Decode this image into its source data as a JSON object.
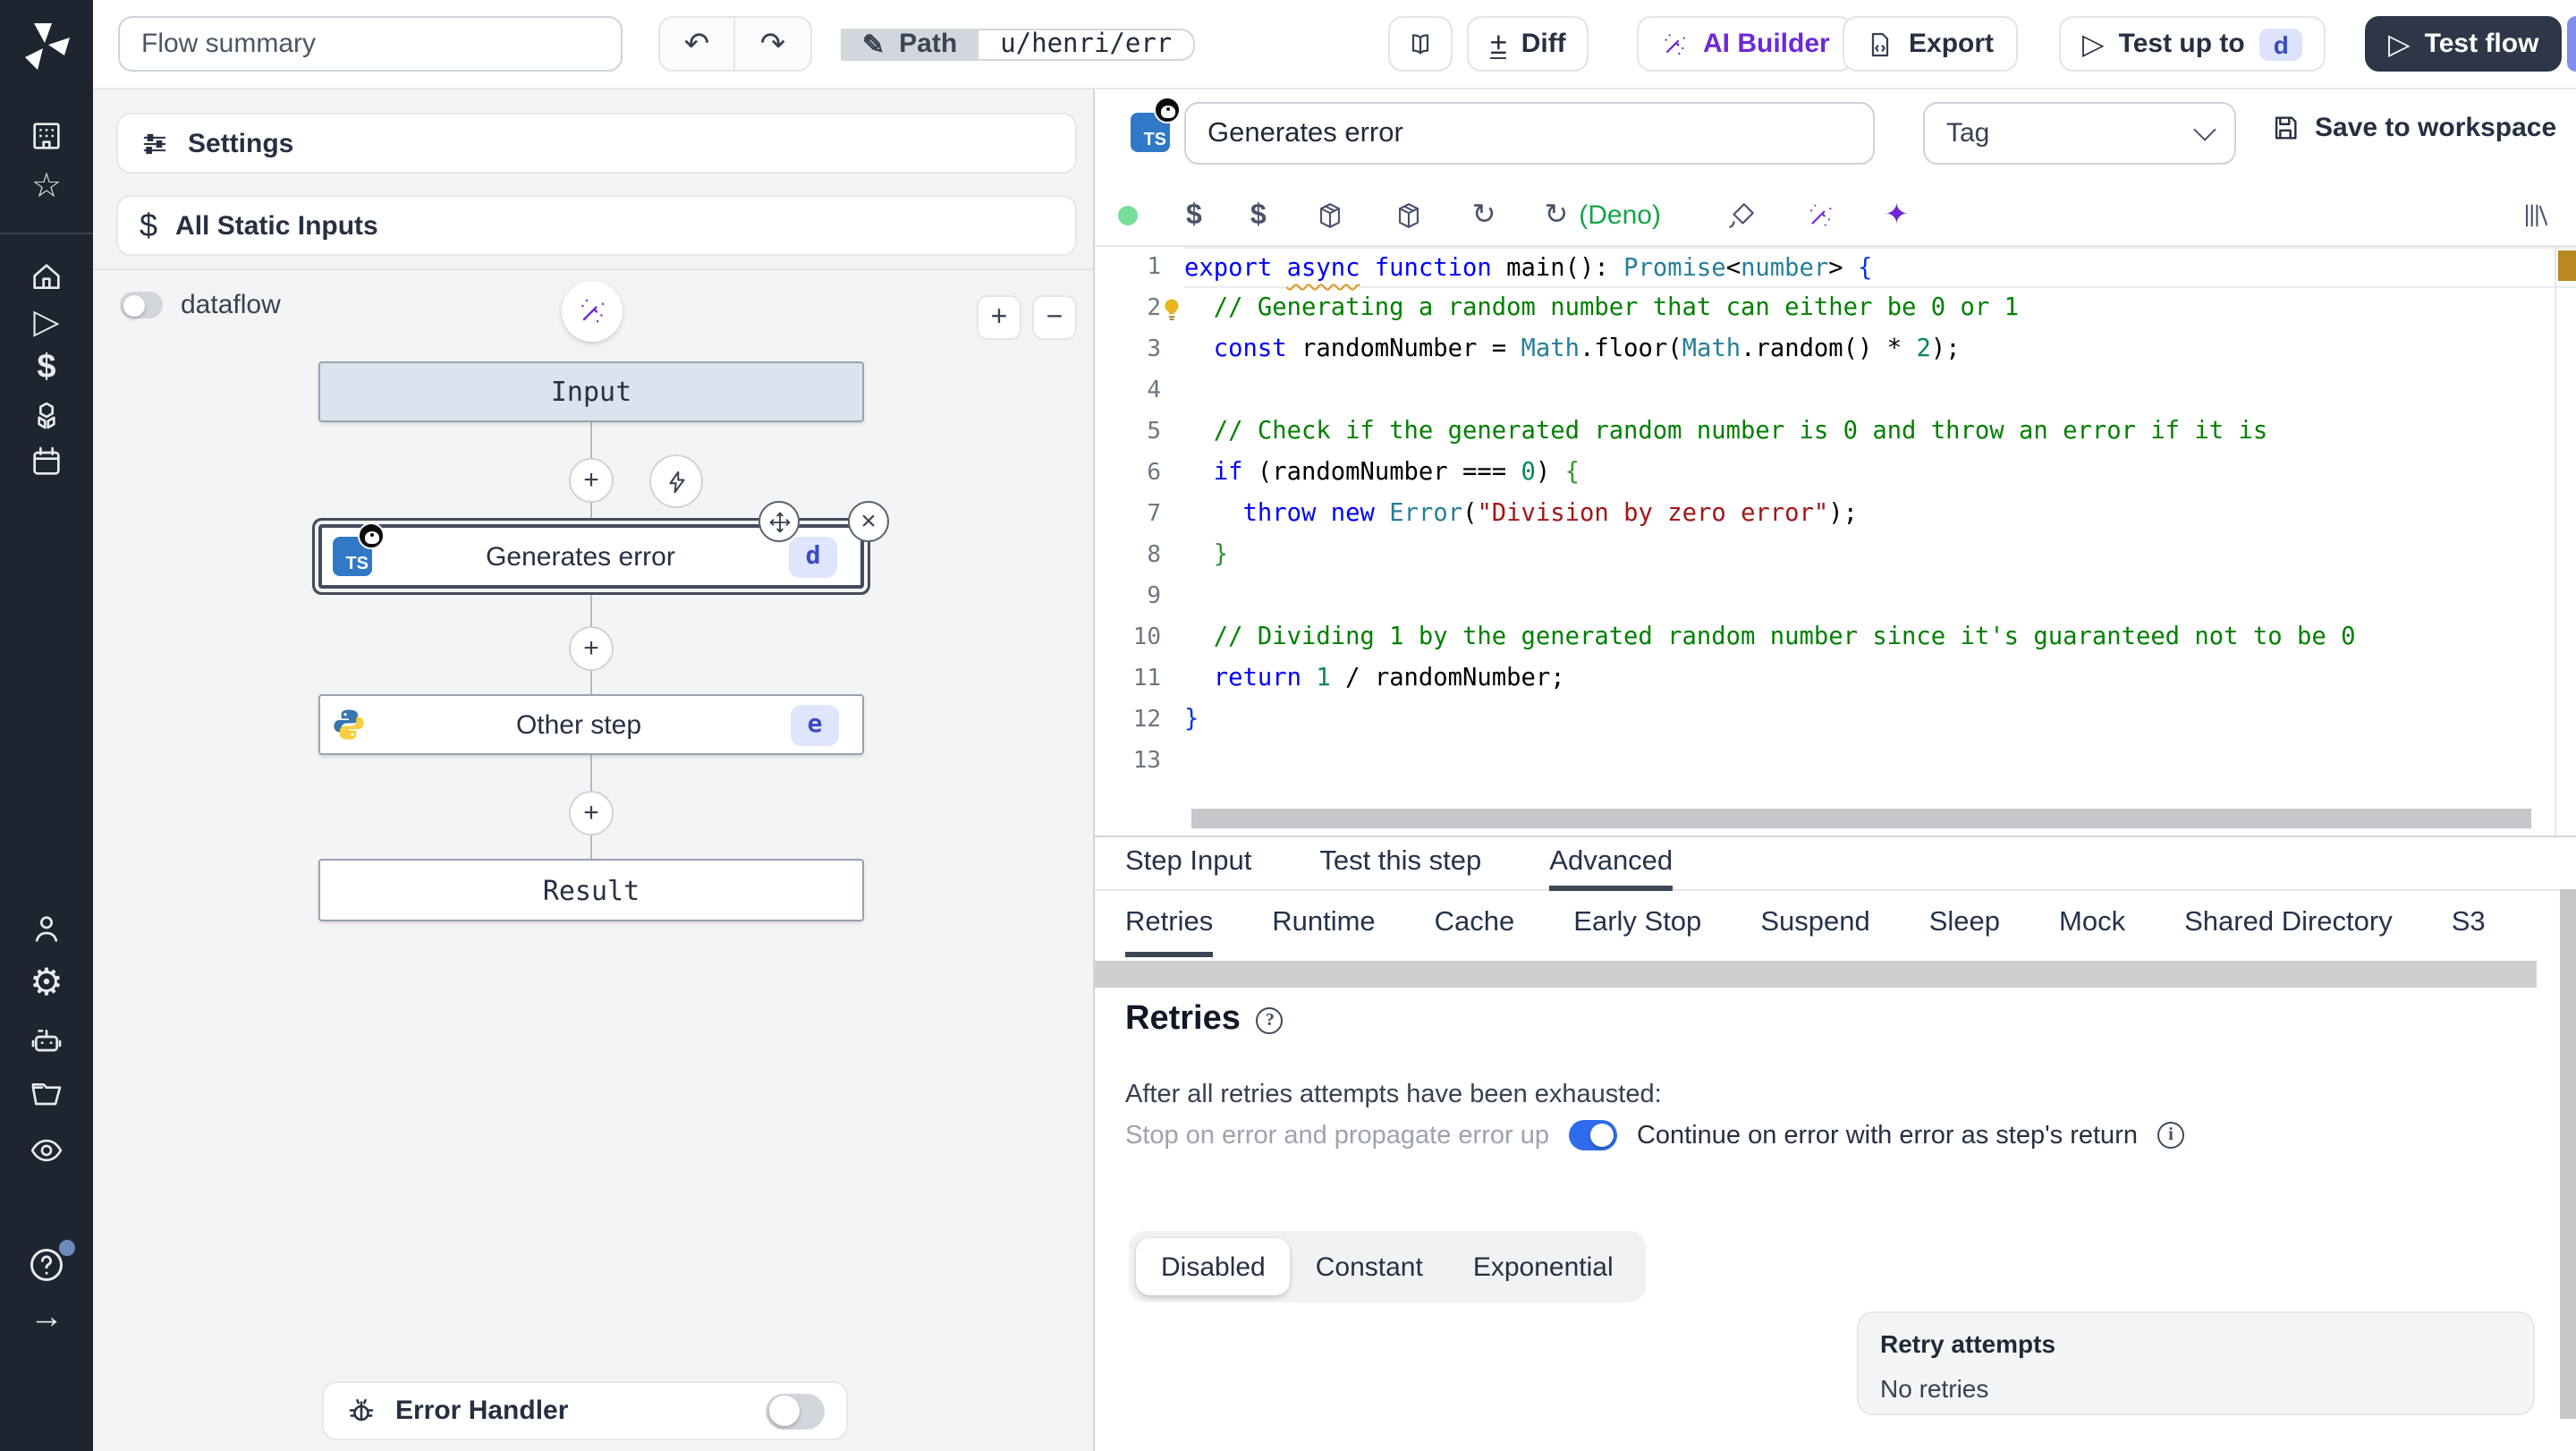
{
  "colors": {
    "accent_blue": "#2f6ceb",
    "ai_purple": "#6d28d9",
    "deno_green": "#16a34a",
    "dark_button": "#2e3748",
    "warning_marker": "#b8891f",
    "sidebar_bg": "#1e2430"
  },
  "icons": {
    "undo": "↶",
    "redo": "↷",
    "pencil": "✎",
    "diff": "±",
    "play": "▷",
    "home": "⌂",
    "star": "☆",
    "gear": "⚙",
    "arrow_right": "→",
    "dollar": "$",
    "help": "?",
    "refresh": "↻",
    "sparkles": "✦",
    "plus": "+",
    "minus": "−",
    "close": "×",
    "move": "✛"
  },
  "topbar": {
    "flow_summary_value": "Flow summary",
    "path_label": "Path",
    "path_value": "u/henri/err",
    "diff_label": "Diff",
    "ai_builder_label": "AI Builder",
    "export_label": "Export",
    "test_up_to_label": "Test up to",
    "test_up_to_badge": "d",
    "test_flow_label": "Test flow"
  },
  "flow_panel": {
    "settings_label": "Settings",
    "static_inputs_label": "All Static Inputs",
    "dataflow_label": "dataflow",
    "input_node": "Input",
    "step_d": {
      "label": "Generates error",
      "id": "d"
    },
    "step_e": {
      "label": "Other step",
      "id": "e"
    },
    "result_node": "Result",
    "error_handler_label": "Error Handler"
  },
  "step_panel": {
    "name_value": "Generates error",
    "tag_placeholder": "Tag",
    "save_label": "Save to workspace",
    "runtime_label": "(Deno)",
    "tabs": [
      {
        "label": "Step Input",
        "active": false
      },
      {
        "label": "Test this step",
        "active": false
      },
      {
        "label": "Advanced",
        "active": true
      }
    ],
    "subtabs": [
      {
        "label": "Retries",
        "active": true
      },
      {
        "label": "Runtime",
        "active": false
      },
      {
        "label": "Cache",
        "active": false
      },
      {
        "label": "Early Stop",
        "active": false
      },
      {
        "label": "Suspend",
        "active": false
      },
      {
        "label": "Sleep",
        "active": false
      },
      {
        "label": "Mock",
        "active": false
      },
      {
        "label": "Shared Directory",
        "active": false
      },
      {
        "label": "S3",
        "active": false
      }
    ],
    "retries": {
      "title": "Retries",
      "exhausted_text": "After all retries attempts have been exhausted:",
      "stop_label": "Stop on error and propagate error up",
      "continue_label": "Continue on error with error as step's return",
      "toggle_on": true,
      "modes": [
        {
          "label": "Disabled",
          "active": true
        },
        {
          "label": "Constant",
          "active": false
        },
        {
          "label": "Exponential",
          "active": false
        }
      ],
      "box_title": "Retry attempts",
      "box_value": "No retries"
    }
  },
  "code": {
    "active_line": 1,
    "bulb_line": 2,
    "lines": [
      [
        [
          "k",
          "export "
        ],
        [
          "k sq",
          "async"
        ],
        [
          "k",
          " function "
        ],
        [
          "",
          "main(): "
        ],
        [
          "t",
          "Promise"
        ],
        [
          "",
          "<"
        ],
        [
          "t",
          "number"
        ],
        [
          "",
          ">"
        ],
        [
          "b1",
          " {"
        ]
      ],
      [
        [
          "",
          "  "
        ],
        [
          "c",
          "// Generating a random number that can either be 0 or 1"
        ]
      ],
      [
        [
          "",
          "  "
        ],
        [
          "k",
          "const "
        ],
        [
          "",
          "randomNumber = "
        ],
        [
          "t",
          "Math"
        ],
        [
          "",
          ".floor("
        ],
        [
          "t",
          "Math"
        ],
        [
          "",
          ".random() * "
        ],
        [
          "n",
          "2"
        ],
        [
          "",
          ");"
        ]
      ],
      [],
      [
        [
          "",
          "  "
        ],
        [
          "c",
          "// Check if the generated random number is 0 and throw an error if it is"
        ]
      ],
      [
        [
          "",
          "  "
        ],
        [
          "k",
          "if "
        ],
        [
          "",
          "(randomNumber === "
        ],
        [
          "n",
          "0"
        ],
        [
          "",
          ") "
        ],
        [
          "b2",
          "{"
        ]
      ],
      [
        [
          "",
          "    "
        ],
        [
          "k",
          "throw "
        ],
        [
          "k",
          "new "
        ],
        [
          "t",
          "Error"
        ],
        [
          "",
          "("
        ],
        [
          "s",
          "\"Division by zero error\""
        ],
        [
          "",
          ");"
        ]
      ],
      [
        [
          "",
          "  "
        ],
        [
          "b2",
          "}"
        ]
      ],
      [],
      [
        [
          "",
          "  "
        ],
        [
          "c",
          "// Dividing 1 by the generated random number since it's guaranteed not to be 0"
        ]
      ],
      [
        [
          "",
          "  "
        ],
        [
          "k",
          "return "
        ],
        [
          "n",
          "1"
        ],
        [
          "",
          " / randomNumber;"
        ]
      ],
      [
        [
          "b1",
          "}"
        ]
      ],
      []
    ]
  }
}
